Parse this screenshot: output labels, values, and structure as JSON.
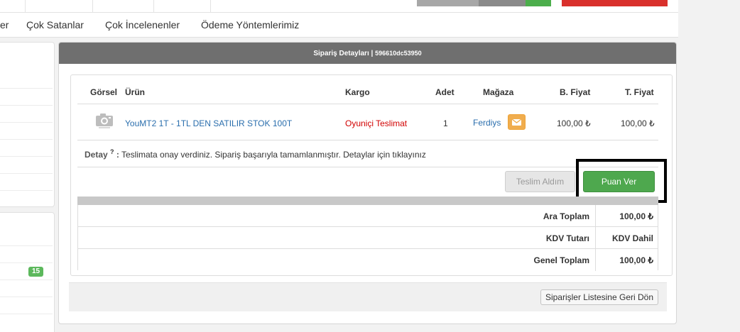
{
  "nav": {
    "items": [
      "er",
      "Çok Satanlar",
      "Çok İncelenenler",
      "Ödeme Yöntemlerimiz"
    ]
  },
  "sidebar": {
    "badge": "15"
  },
  "panel": {
    "title": "Sipariş Detayları",
    "separator": "|",
    "order_id": "596610dc53950"
  },
  "table": {
    "headers": {
      "image": "Görsel",
      "product": "Ürün",
      "shipping": "Kargo",
      "qty": "Adet",
      "store": "Mağaza",
      "unit_price": "B. Fiyat",
      "total_price": "T. Fiyat"
    },
    "row": {
      "product": "YouMT2 1T - 1TL DEN SATILIR STOK 100T",
      "shipping": "Oyuniçi Teslimat",
      "qty": "1",
      "store": "Ferdiys",
      "unit_price": "100,00 ₺",
      "total_price": "100,00 ₺"
    }
  },
  "detail": {
    "label": "Detay",
    "sup": "?",
    "colon": ":",
    "text": "Teslimata onay verdiniz. Sipariş başarıyla tamamlanmıştır. Detaylar için tıklayınız"
  },
  "actions": {
    "received": "Teslim Aldım",
    "rate": "Puan Ver"
  },
  "totals": {
    "subtotal_label": "Ara Toplam",
    "subtotal_value": "100,00 ₺",
    "vat_label": "KDV Tutarı",
    "vat_value": "KDV Dahil",
    "grand_label": "Genel Toplam",
    "grand_value": "100,00 ₺"
  },
  "footer": {
    "back": "Siparişler Listesine Geri Dön"
  },
  "colors": {
    "panel_header": "#6f6f6f",
    "success": "#4ea84e",
    "warning": "#f0ad4e",
    "danger": "#d9302c",
    "link": "#2a6ead"
  },
  "icons": [
    "camera-icon",
    "envelope-icon"
  ]
}
